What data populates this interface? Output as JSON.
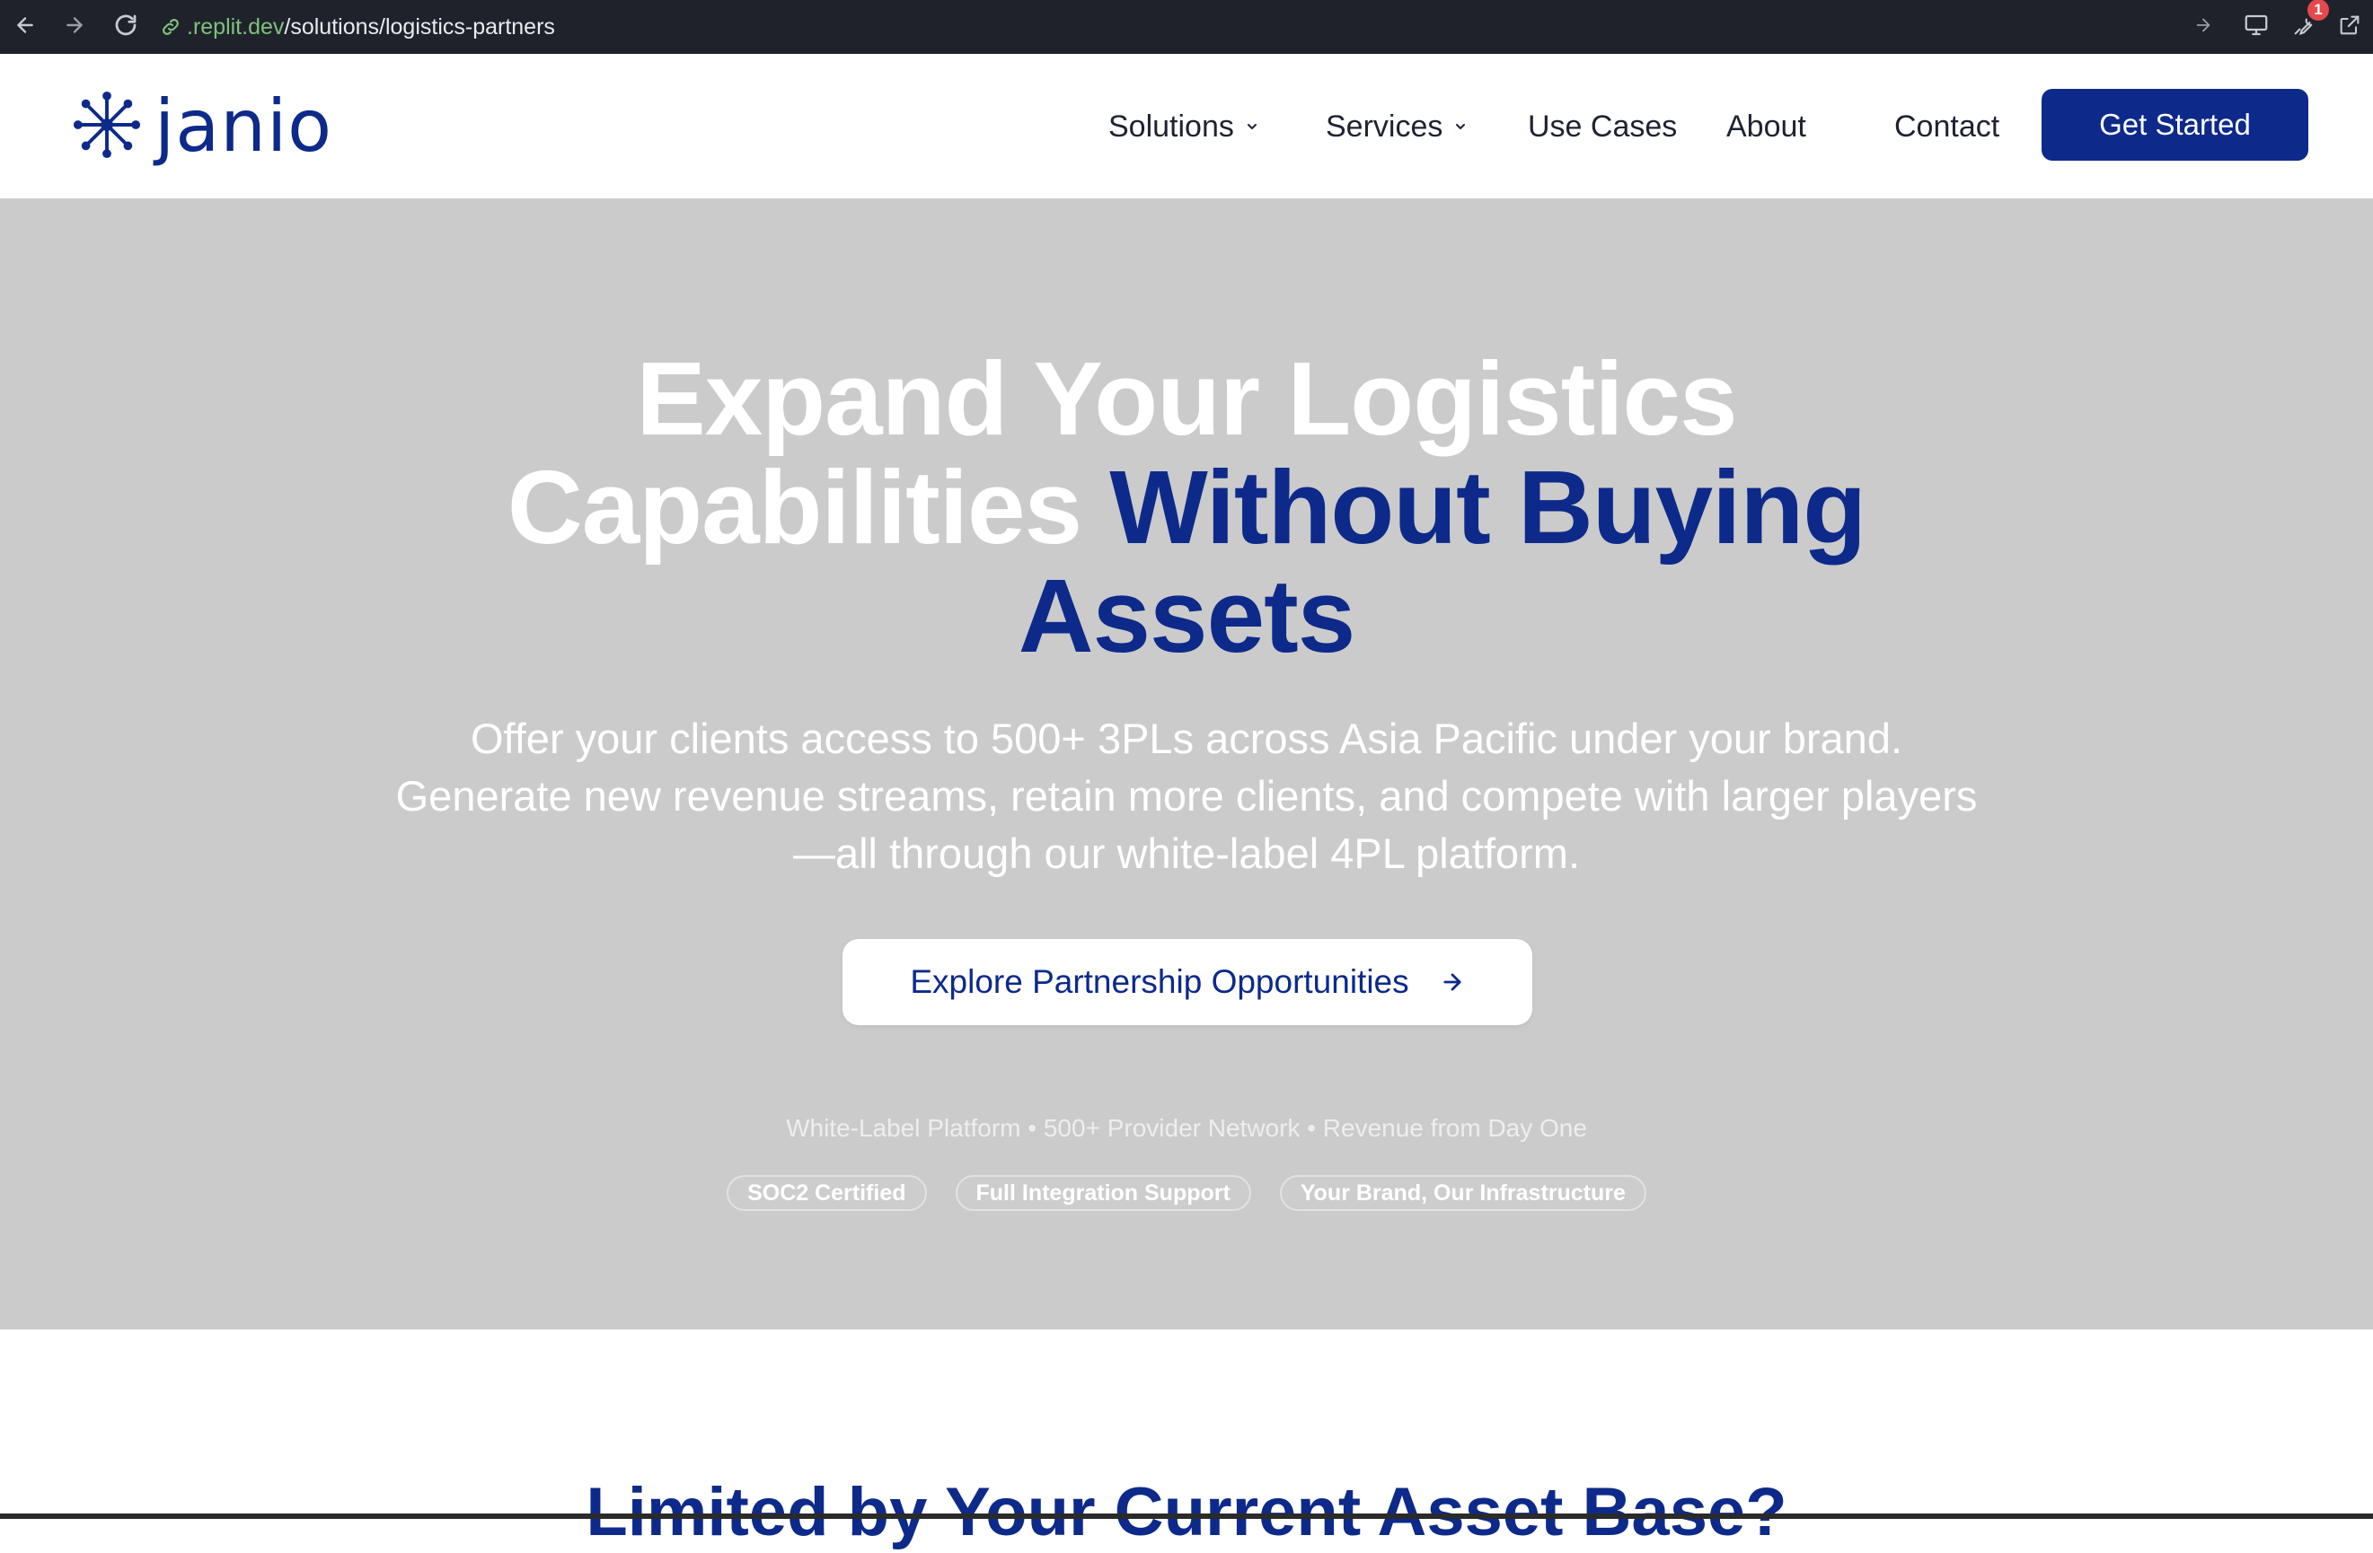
{
  "browser": {
    "url_host": ".replit.dev",
    "url_path": "/solutions/logistics-partners",
    "notification_count": "1"
  },
  "header": {
    "logo_text": "janio",
    "nav": {
      "solutions": "Solutions",
      "services": "Services",
      "use_cases": "Use Cases",
      "about": "About",
      "contact": "Contact"
    },
    "cta": "Get Started"
  },
  "hero": {
    "title_line1": "Expand Your Logistics",
    "title_line2_plain": "Capabilities ",
    "title_line2_accent": "Without Buying",
    "title_line3_accent": "Assets",
    "subtitle": "Offer your clients access to 500+ 3PLs across Asia Pacific under your brand. Generate new revenue streams, retain more clients, and compete with larger players—all through our white-label 4PL platform.",
    "cta": "Explore Partnership Opportunities",
    "features": "White-Label Platform • 500+ Provider Network • Revenue from Day One",
    "pills": [
      "SOC2 Certified",
      "Full Integration Support",
      "Your Brand, Our Infrastructure"
    ]
  },
  "next_section": {
    "title": "Limited by Your Current Asset Base?"
  },
  "colors": {
    "brand_navy": "#0d2a8a",
    "hero_bg": "#cbcbcb",
    "chrome_bg": "#1f222b"
  }
}
